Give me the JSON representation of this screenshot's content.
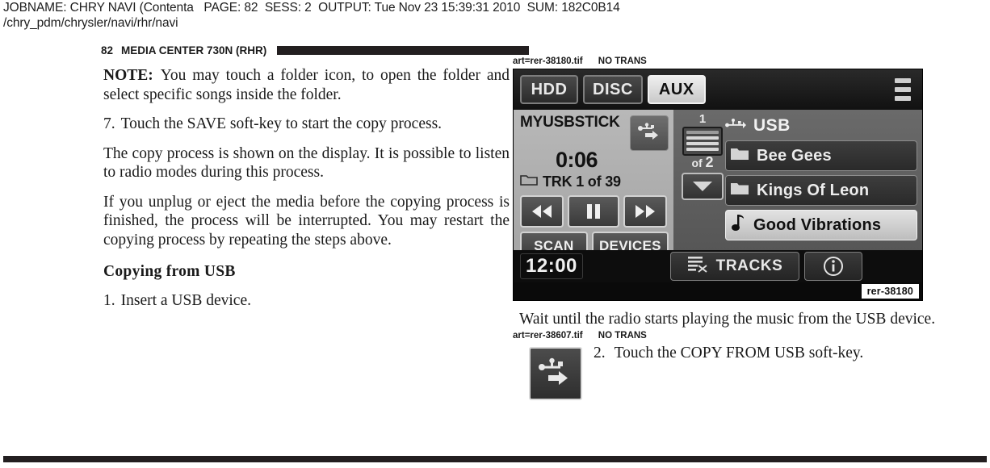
{
  "jobinfo": {
    "line1": "JOBNAME: CHRY NAVI (Contenta   PAGE: 82  SESS: 2  OUTPUT: Tue Nov 23 15:39:31 2010  SUM: 182C0B14",
    "line2": "/chry_pdm/chrysler/navi/rhr/navi"
  },
  "running_head": {
    "page_number": "82",
    "title": "MEDIA CENTER 730N (RHR)"
  },
  "left_column": {
    "note_label": "NOTE:",
    "note_text": "You may touch a folder icon, to open the folder and select specific songs inside the folder.",
    "step7_number": "7.",
    "step7_text": "Touch the SAVE soft-key to start the copy process.",
    "para_copy_process": "The copy process is shown on the display. It is possible to listen to radio modes during this process.",
    "para_unplug": "If you unplug or eject the media before the copying process is finished, the process will be interrupted. You may restart the copying process by repeating the steps above.",
    "subhead": "Copying from USB",
    "step1_number": "1.",
    "step1_text": "Insert a USB device."
  },
  "right_column": {
    "art_label_1": "art=rer-38180.tif",
    "no_trans_1": "NO TRANS",
    "caption_wait": "Wait until the radio starts playing the music from the USB device.",
    "art_label_2": "art=rer-38607.tif",
    "no_trans_2": "NO TRANS",
    "step2_number": "2.",
    "step2_text": "Touch the COPY FROM USB soft-key."
  },
  "radio_screen": {
    "figure_code": "rer-38180",
    "sources": [
      {
        "label": "HDD",
        "active": false
      },
      {
        "label": "DISC",
        "active": false
      },
      {
        "label": "AUX",
        "active": true
      }
    ],
    "player": {
      "device_name": "MYUSBSTICK",
      "elapsed_time": "0:06",
      "track_text": "TRK 1 of 39",
      "prev_icon": "rewind-icon",
      "pause_icon": "pause-icon",
      "next_icon": "fast-forward-icon",
      "usb_icon": "usb-copy-icon"
    },
    "soft_keys": [
      {
        "label": "SCAN"
      },
      {
        "label": "DEVICES"
      }
    ],
    "browser": {
      "source_label": "USB",
      "source_icon": "usb-icon",
      "page_current": "1",
      "page_of_label": "of",
      "page_total": "2",
      "list_icon": "list-page-icon",
      "down_icon": "chevron-down-icon",
      "items": [
        {
          "label": "Bee Gees",
          "icon": "folder-icon",
          "selected": false
        },
        {
          "label": "Kings Of Leon",
          "icon": "folder-icon",
          "selected": false
        },
        {
          "label": "Good Vibrations",
          "icon": "music-note-icon",
          "selected": true
        }
      ]
    },
    "bottom": {
      "clock": "12:00",
      "tracks_label": "TRACKS",
      "tracks_icon": "tracks-list-icon",
      "info_icon": "info-icon"
    },
    "colors": {
      "screen_bg": "#0a0a0a",
      "panel_light": "#b0b0b0",
      "panel_mid": "#5e5e5e",
      "selected_row": "#d6d6d6",
      "text_light": "#ececec"
    }
  }
}
